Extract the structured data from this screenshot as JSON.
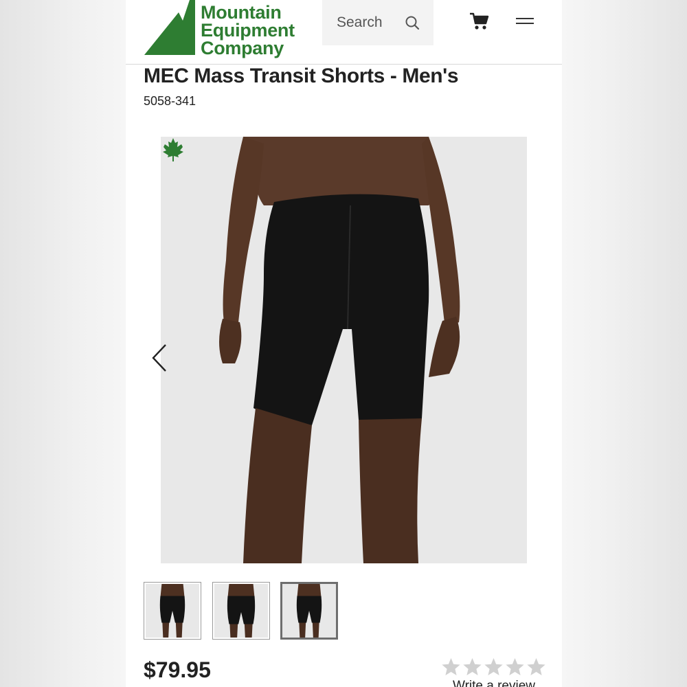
{
  "header": {
    "logo": {
      "line1": "Mountain",
      "line2": "Equipment",
      "line3": "Company"
    },
    "search": {
      "placeholder": "Search",
      "icon": "search-icon"
    },
    "cart_icon": "cart-icon",
    "menu_icon": "hamburger-menu-icon"
  },
  "product": {
    "title": "MEC Mass Transit Shorts - Men's",
    "sku": "5058-341",
    "badge_icon": "maple-leaf-icon",
    "gallery": {
      "prev_icon": "chevron-left-icon",
      "thumbnail_count": 3,
      "active_thumbnail": 3
    },
    "price": "$79.95",
    "rating": {
      "stars_total": 5,
      "stars_filled": 0
    },
    "review_link": "Write a review"
  },
  "colors": {
    "brand_green": "#2e7d32",
    "text": "#222222",
    "star_empty": "#d0d0d0"
  }
}
